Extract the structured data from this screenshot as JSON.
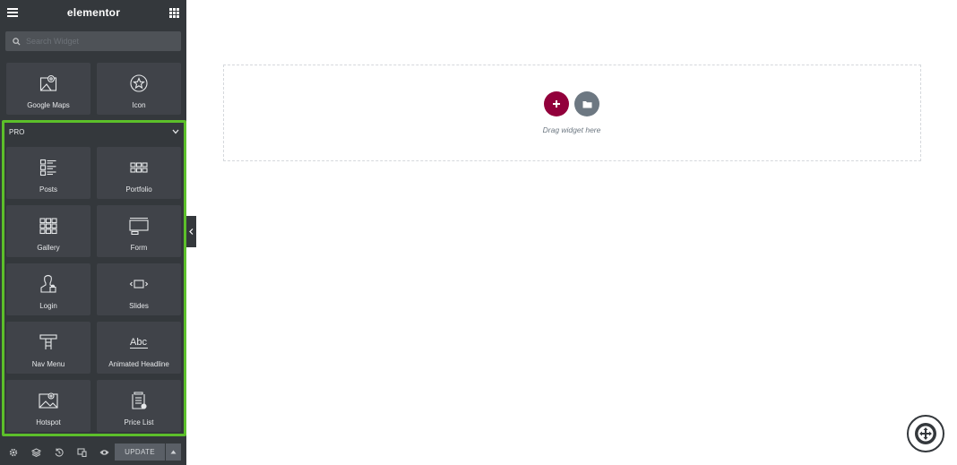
{
  "header": {
    "logo": "elementor"
  },
  "search": {
    "placeholder": "Search Widget"
  },
  "widgets_top": [
    {
      "label": "Google Maps",
      "icon": "map-pin-icon"
    },
    {
      "label": "Icon",
      "icon": "star-circle-icon"
    }
  ],
  "pro": {
    "title": "PRO",
    "widgets": [
      {
        "label": "Posts",
        "icon": "posts-icon"
      },
      {
        "label": "Portfolio",
        "icon": "portfolio-icon"
      },
      {
        "label": "Gallery",
        "icon": "gallery-icon"
      },
      {
        "label": "Form",
        "icon": "form-icon"
      },
      {
        "label": "Login",
        "icon": "login-icon"
      },
      {
        "label": "Slides",
        "icon": "slides-icon"
      },
      {
        "label": "Nav Menu",
        "icon": "nav-menu-icon"
      },
      {
        "label": "Animated Headline",
        "icon": "animated-headline-icon"
      },
      {
        "label": "Hotspot",
        "icon": "hotspot-icon"
      },
      {
        "label": "Price List",
        "icon": "price-list-icon"
      }
    ]
  },
  "footer": {
    "update_label": "UPDATE"
  },
  "canvas": {
    "drag_text": "Drag widget here"
  },
  "colors": {
    "panel": "#34383c",
    "tile": "#404349",
    "accent": "#92003b",
    "highlight": "#5cbf2a"
  }
}
